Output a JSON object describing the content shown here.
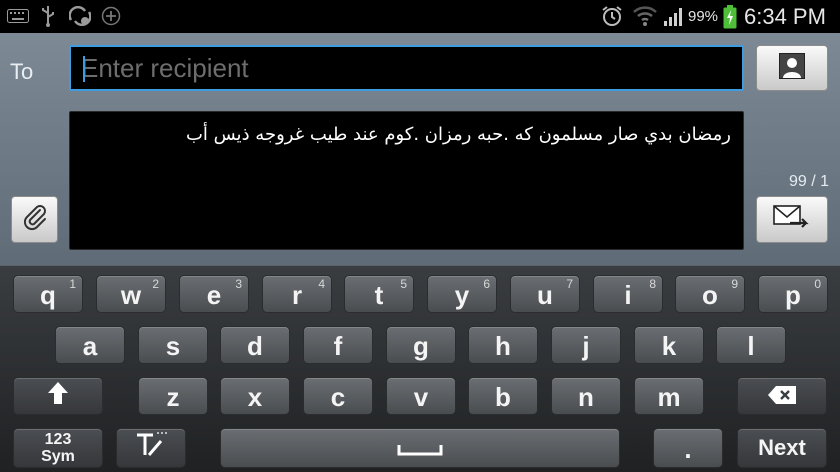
{
  "status_bar": {
    "left_icons": [
      "keyboard-icon",
      "usb-icon",
      "sync-error-icon",
      "add-icon"
    ],
    "right_icons": [
      "alarm-icon",
      "wifi-icon",
      "signal-icon",
      "battery-icon"
    ],
    "battery_percent": "99%",
    "time": "6:34 PM"
  },
  "compose": {
    "to_label": "To",
    "recipient_placeholder": "Enter recipient",
    "message_text": "رمضان بدي صار مسلمون كه .حبه رمزان .كوم عند طيب غروجه ذيس أب",
    "char_counter": "99 / 1",
    "contacts_button_icon": "contact-icon",
    "attach_button_icon": "paperclip-icon",
    "send_button_icon": "send-icon"
  },
  "keyboard": {
    "row1": [
      {
        "key": "q",
        "sup": "1"
      },
      {
        "key": "w",
        "sup": "2"
      },
      {
        "key": "e",
        "sup": "3"
      },
      {
        "key": "r",
        "sup": "4"
      },
      {
        "key": "t",
        "sup": "5"
      },
      {
        "key": "y",
        "sup": "6"
      },
      {
        "key": "u",
        "sup": "7"
      },
      {
        "key": "i",
        "sup": "8"
      },
      {
        "key": "o",
        "sup": "9"
      },
      {
        "key": "p",
        "sup": "0"
      }
    ],
    "row2": [
      "a",
      "s",
      "d",
      "f",
      "g",
      "h",
      "j",
      "k",
      "l"
    ],
    "row3": [
      "z",
      "x",
      "c",
      "v",
      "b",
      "n",
      "m"
    ],
    "sym_line1": "123",
    "sym_line2": "Sym",
    "period": ".",
    "next": "Next"
  }
}
